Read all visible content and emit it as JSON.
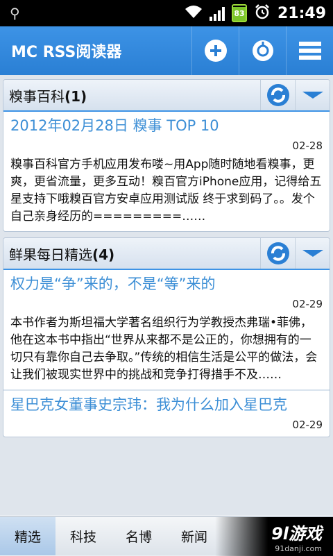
{
  "statusbar": {
    "battery": "83",
    "time": "21:49"
  },
  "header": {
    "app_title": "MC RSS阅读器"
  },
  "feeds": [
    {
      "title": "糗事百科",
      "count": "(1)",
      "items": [
        {
          "title": "2012年02月28日 糗事 TOP 10",
          "date": "02-28",
          "summary": "糗事百科官方手机应用发布喽~用App随时随地看糗事，更爽，更省流量，更多互动！糗百官方iPhone应用，记得给五星支持下哦糗百官方安卓应用测试版 终于求到码了。。发个自己亲身经历的=========……"
        }
      ]
    },
    {
      "title": "鲜果每日精选",
      "count": "(4)",
      "items": [
        {
          "title": "权力是“争”来的，不是“等”来的",
          "date": "02-29",
          "summary": "本书作者为斯坦福大学著名组织行为学教授杰弗瑞•菲佛，他在这本书中指出“世界从来都不是公正的，你想拥有的一切只有靠你自己去争取。”传统的相信生活是公平的做法，会让我们被现实世界中的挑战和竞争打得措手不及……"
        },
        {
          "title": "星巴克女董事史宗玮：我为什么加入星巴克",
          "date": "02-29",
          "summary": ""
        }
      ]
    }
  ],
  "tabs": [
    {
      "label": "精选"
    },
    {
      "label": "科技"
    },
    {
      "label": "名博"
    },
    {
      "label": "新闻"
    }
  ],
  "watermark": {
    "main": "9l游戏",
    "sub": "91danji.com"
  },
  "colors": {
    "accent": "#2a7fd4",
    "link": "#3d8fd6"
  }
}
